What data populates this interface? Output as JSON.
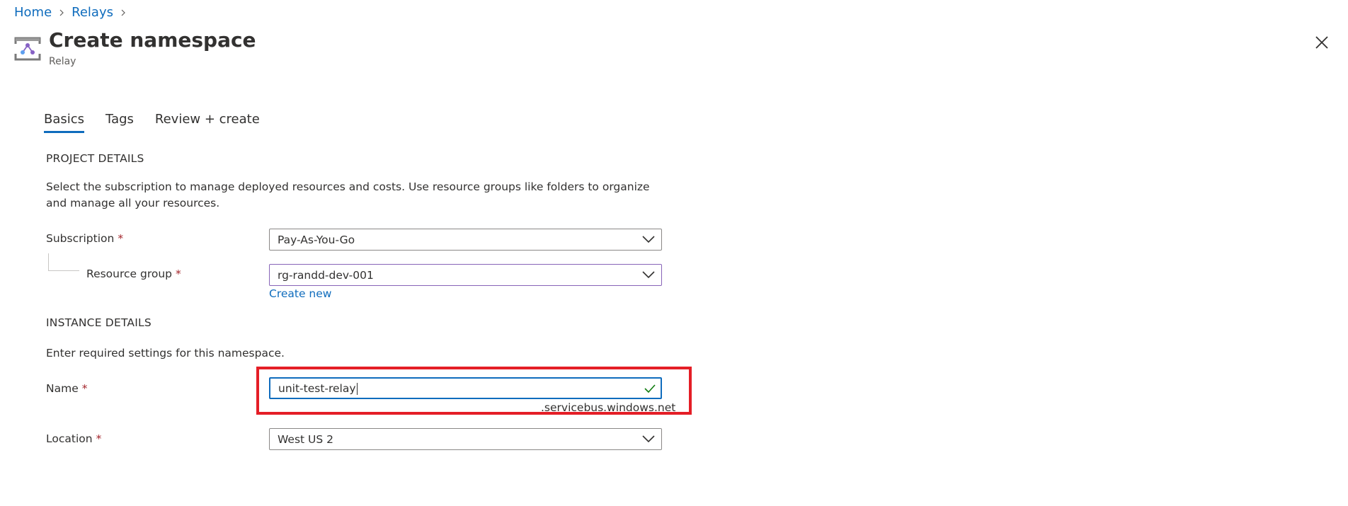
{
  "breadcrumb": {
    "home": "Home",
    "relays": "Relays"
  },
  "header": {
    "title": "Create namespace",
    "subtitle": "Relay"
  },
  "tabs": [
    {
      "label": "Basics",
      "active": true
    },
    {
      "label": "Tags",
      "active": false
    },
    {
      "label": "Review + create",
      "active": false
    }
  ],
  "project": {
    "heading": "PROJECT DETAILS",
    "description": "Select the subscription to manage deployed resources and costs. Use resource groups like folders to organize and manage all your resources.",
    "subscription_label": "Subscription",
    "subscription_value": "Pay-As-You-Go",
    "resource_group_label": "Resource group",
    "resource_group_value": "rg-randd-dev-001",
    "create_new": "Create new"
  },
  "instance": {
    "heading": "INSTANCE DETAILS",
    "description": "Enter required settings for this namespace.",
    "name_label": "Name",
    "name_value": "unit-test-relay",
    "name_suffix": ".servicebus.windows.net",
    "location_label": "Location",
    "location_value": "West US 2"
  },
  "required_mark": "*",
  "colors": {
    "accent": "#0f6cbd",
    "required": "#a4262c",
    "highlight": "#e41e26",
    "valid": "#107c10",
    "focus_purple": "#8764b8"
  }
}
